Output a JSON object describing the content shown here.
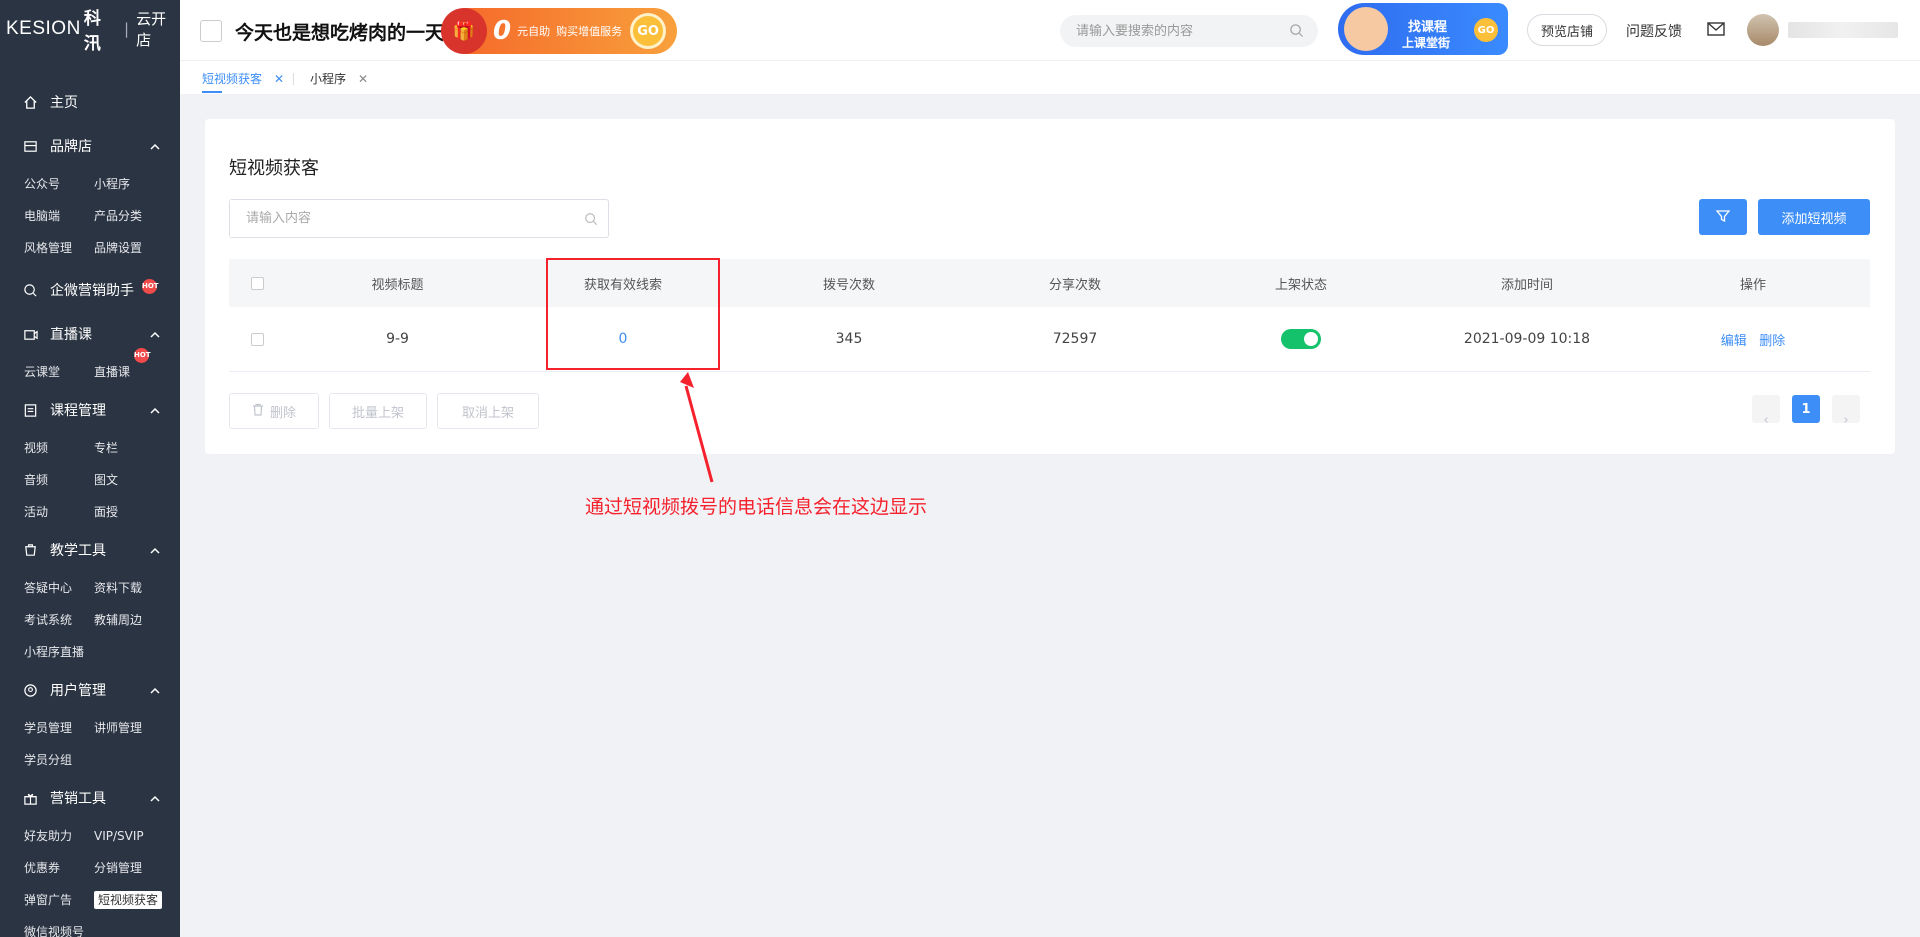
{
  "brand": {
    "name_en": "KESION",
    "name_cn": "科汛",
    "product": "云开店"
  },
  "topbar": {
    "slogan": "今天也是想吃烤肉的一天",
    "promo": {
      "zero": "0",
      "unit": "元自助",
      "text": "购买增值服务",
      "go": "GO"
    },
    "search_placeholder": "请输入要搜索的内容",
    "banner": {
      "line1": "找课程",
      "line2": "上课堂街",
      "go": "GO"
    },
    "preview_label": "预览店铺",
    "feedback_label": "问题反馈"
  },
  "sidebar": {
    "home": "主页",
    "groups": [
      {
        "title": "品牌店",
        "items": [
          "公众号",
          "小程序",
          "电脑端",
          "产品分类",
          "风格管理",
          "品牌设置"
        ]
      },
      {
        "title": "企微营销助手",
        "hot": "HOT",
        "items": []
      },
      {
        "title": "直播课",
        "items": [
          "云课堂",
          "直播课"
        ],
        "hot": "HOT"
      },
      {
        "title": "课程管理",
        "items": [
          "视频",
          "专栏",
          "音频",
          "图文",
          "活动",
          "面授"
        ]
      },
      {
        "title": "教学工具",
        "items": [
          "答疑中心",
          "资料下载",
          "考试系统",
          "教辅周边",
          "小程序直播"
        ]
      },
      {
        "title": "用户管理",
        "items": [
          "学员管理",
          "讲师管理",
          "学员分组"
        ]
      },
      {
        "title": "营销工具",
        "items": [
          "好友助力",
          "VIP/SVIP",
          "优惠券",
          "分销管理",
          "弹窗广告",
          "短视频获客",
          "微信视频号"
        ]
      }
    ]
  },
  "tabs": [
    {
      "label": "短视频获客",
      "active": true
    },
    {
      "label": "小程序",
      "active": false
    }
  ],
  "page": {
    "title": "短视频获客",
    "search_placeholder": "请输入内容",
    "add_button": "添加短视频",
    "columns": [
      "视频标题",
      "获取有效线索",
      "拨号次数",
      "分享次数",
      "上架状态",
      "添加时间",
      "操作"
    ],
    "rows": [
      {
        "title": "9-9",
        "leads": "0",
        "dials": "345",
        "shares": "72597",
        "listed": true,
        "added": "2021-09-09 10:18",
        "edit": "编辑",
        "delete": "删除"
      }
    ],
    "bulk": {
      "delete": "删除",
      "list": "批量上架",
      "unlist": "取消上架"
    },
    "pagination": {
      "current": "1"
    }
  },
  "annotation": {
    "text": "通过短视频拨号的电话信息会在这边显示"
  },
  "colors": {
    "primary": "#3e8ef7",
    "sidebar_bg": "#2b3442",
    "switch_on": "#13c26b",
    "annotation": "#f5222d"
  }
}
